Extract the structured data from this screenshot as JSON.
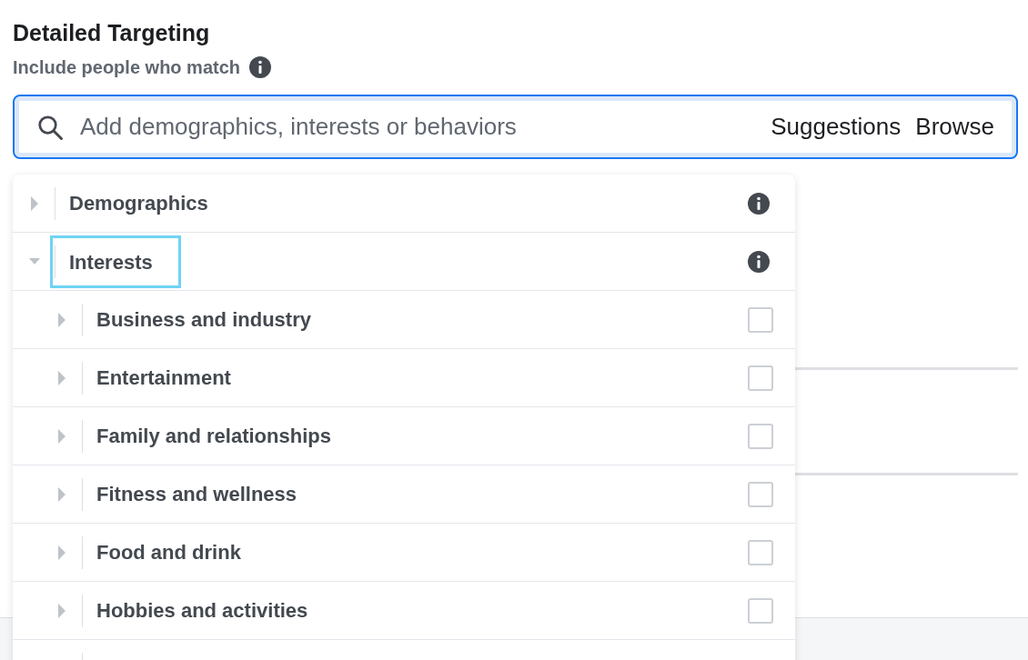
{
  "heading": "Detailed Targeting",
  "subheading": "Include people who match",
  "search": {
    "placeholder": "Add demographics, interests or behaviors",
    "actions": [
      {
        "label": "Suggestions"
      },
      {
        "label": "Browse"
      }
    ]
  },
  "tree": [
    {
      "label": "Demographics",
      "expanded": false,
      "selected": false
    },
    {
      "label": "Interests",
      "expanded": true,
      "selected": true,
      "children": [
        {
          "label": "Business and industry",
          "expanded": false,
          "checked": false
        },
        {
          "label": "Entertainment",
          "expanded": false,
          "checked": false
        },
        {
          "label": "Family and relationships",
          "expanded": false,
          "checked": false
        },
        {
          "label": "Fitness and wellness",
          "expanded": false,
          "checked": false
        },
        {
          "label": "Food and drink",
          "expanded": false,
          "checked": false
        },
        {
          "label": "Hobbies and activities",
          "expanded": false,
          "checked": false
        }
      ]
    }
  ]
}
